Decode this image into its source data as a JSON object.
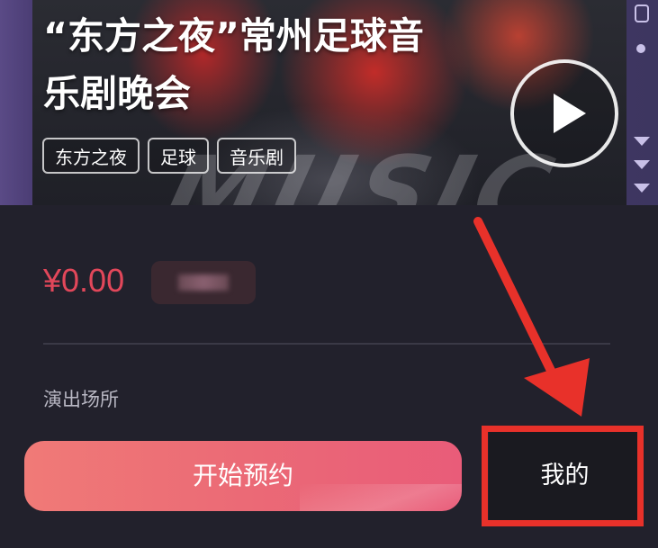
{
  "banner": {
    "title_line1": "“东方之夜”常州足球音",
    "title_line2": "乐剧晚会",
    "poster_art_text": "MUSIC",
    "tags": [
      "东方之夜",
      "足球",
      "音乐剧"
    ]
  },
  "price": "¥0.00",
  "venue_label": "演出场所",
  "actions": {
    "book_label": "开始预约",
    "mine_label": "我的"
  },
  "colors": {
    "price": "#e2475a",
    "book_button": "#eb6a76",
    "highlight": "#e8312a",
    "background": "#22212c"
  }
}
